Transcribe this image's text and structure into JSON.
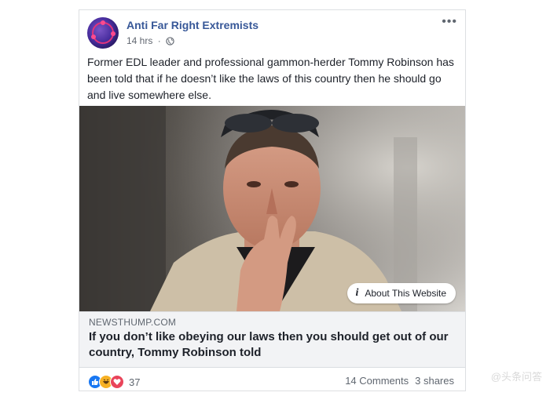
{
  "post": {
    "page_name": "Anti Far Right Extremists",
    "time": "14 hrs",
    "separator": "·",
    "text": "Former EDL leader and professional gammon-herder Tommy Robinson has been told that if he doesn’t like the laws of this country then he should go and live somewhere else.",
    "more_label": "•••"
  },
  "link": {
    "about_label": "About This Website",
    "info_icon": "i",
    "domain": "NEWSTHUMP.COM",
    "headline": "If you don’t like obeying our laws then you should get out of our country, Tommy Robinson told"
  },
  "footer": {
    "reaction_count": "37",
    "comments": "14 Comments",
    "shares": "3 shares"
  },
  "watermark": "@头条问答",
  "colors": {
    "page_name": "#385898",
    "like": "#1877f2",
    "haha": "#f7b125",
    "love": "#e9445a"
  }
}
